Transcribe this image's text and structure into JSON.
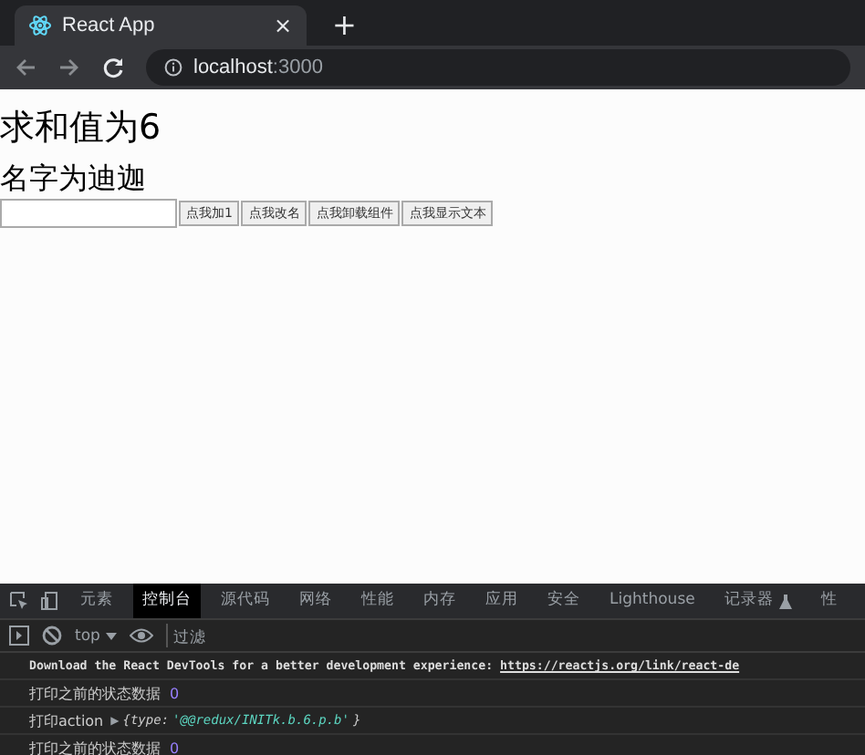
{
  "browser": {
    "tab": {
      "title": "React App",
      "close": "×"
    },
    "new_tab": "+",
    "address": {
      "host": "localhost",
      "port": ":3000"
    }
  },
  "page": {
    "sum_heading": "求和值为6",
    "name_heading": "名字为迪迦",
    "buttons": [
      "点我加1",
      "点我改名",
      "点我卸载组件",
      "点我显示文本"
    ]
  },
  "devtools": {
    "tabs": [
      {
        "label": "元素",
        "selected": false
      },
      {
        "label": "控制台",
        "selected": true
      },
      {
        "label": "源代码",
        "selected": false
      },
      {
        "label": "网络",
        "selected": false
      },
      {
        "label": "性能",
        "selected": false
      },
      {
        "label": "内存",
        "selected": false
      },
      {
        "label": "应用",
        "selected": false
      },
      {
        "label": "安全",
        "selected": false
      },
      {
        "label": "Lighthouse",
        "selected": false
      },
      {
        "label": "记录器",
        "selected": false,
        "flask": true
      },
      {
        "label": "性",
        "selected": false
      }
    ],
    "context": "top",
    "filter": {
      "placeholder": "过滤"
    },
    "console": [
      {
        "kind": "message",
        "text": "Download the React DevTools for a better development experience: ",
        "link": "https://reactjs.org/link/react-de"
      },
      {
        "kind": "log",
        "text": "打印之前的状态数据",
        "value": "0"
      },
      {
        "kind": "object",
        "text": "打印action",
        "arrow": "▶",
        "open": "{type: ",
        "value": "'@@redux/INITk.b.6.p.b'",
        "close": "}"
      },
      {
        "kind": "log",
        "text": "打印之前的状态数据",
        "value": "0"
      }
    ]
  }
}
